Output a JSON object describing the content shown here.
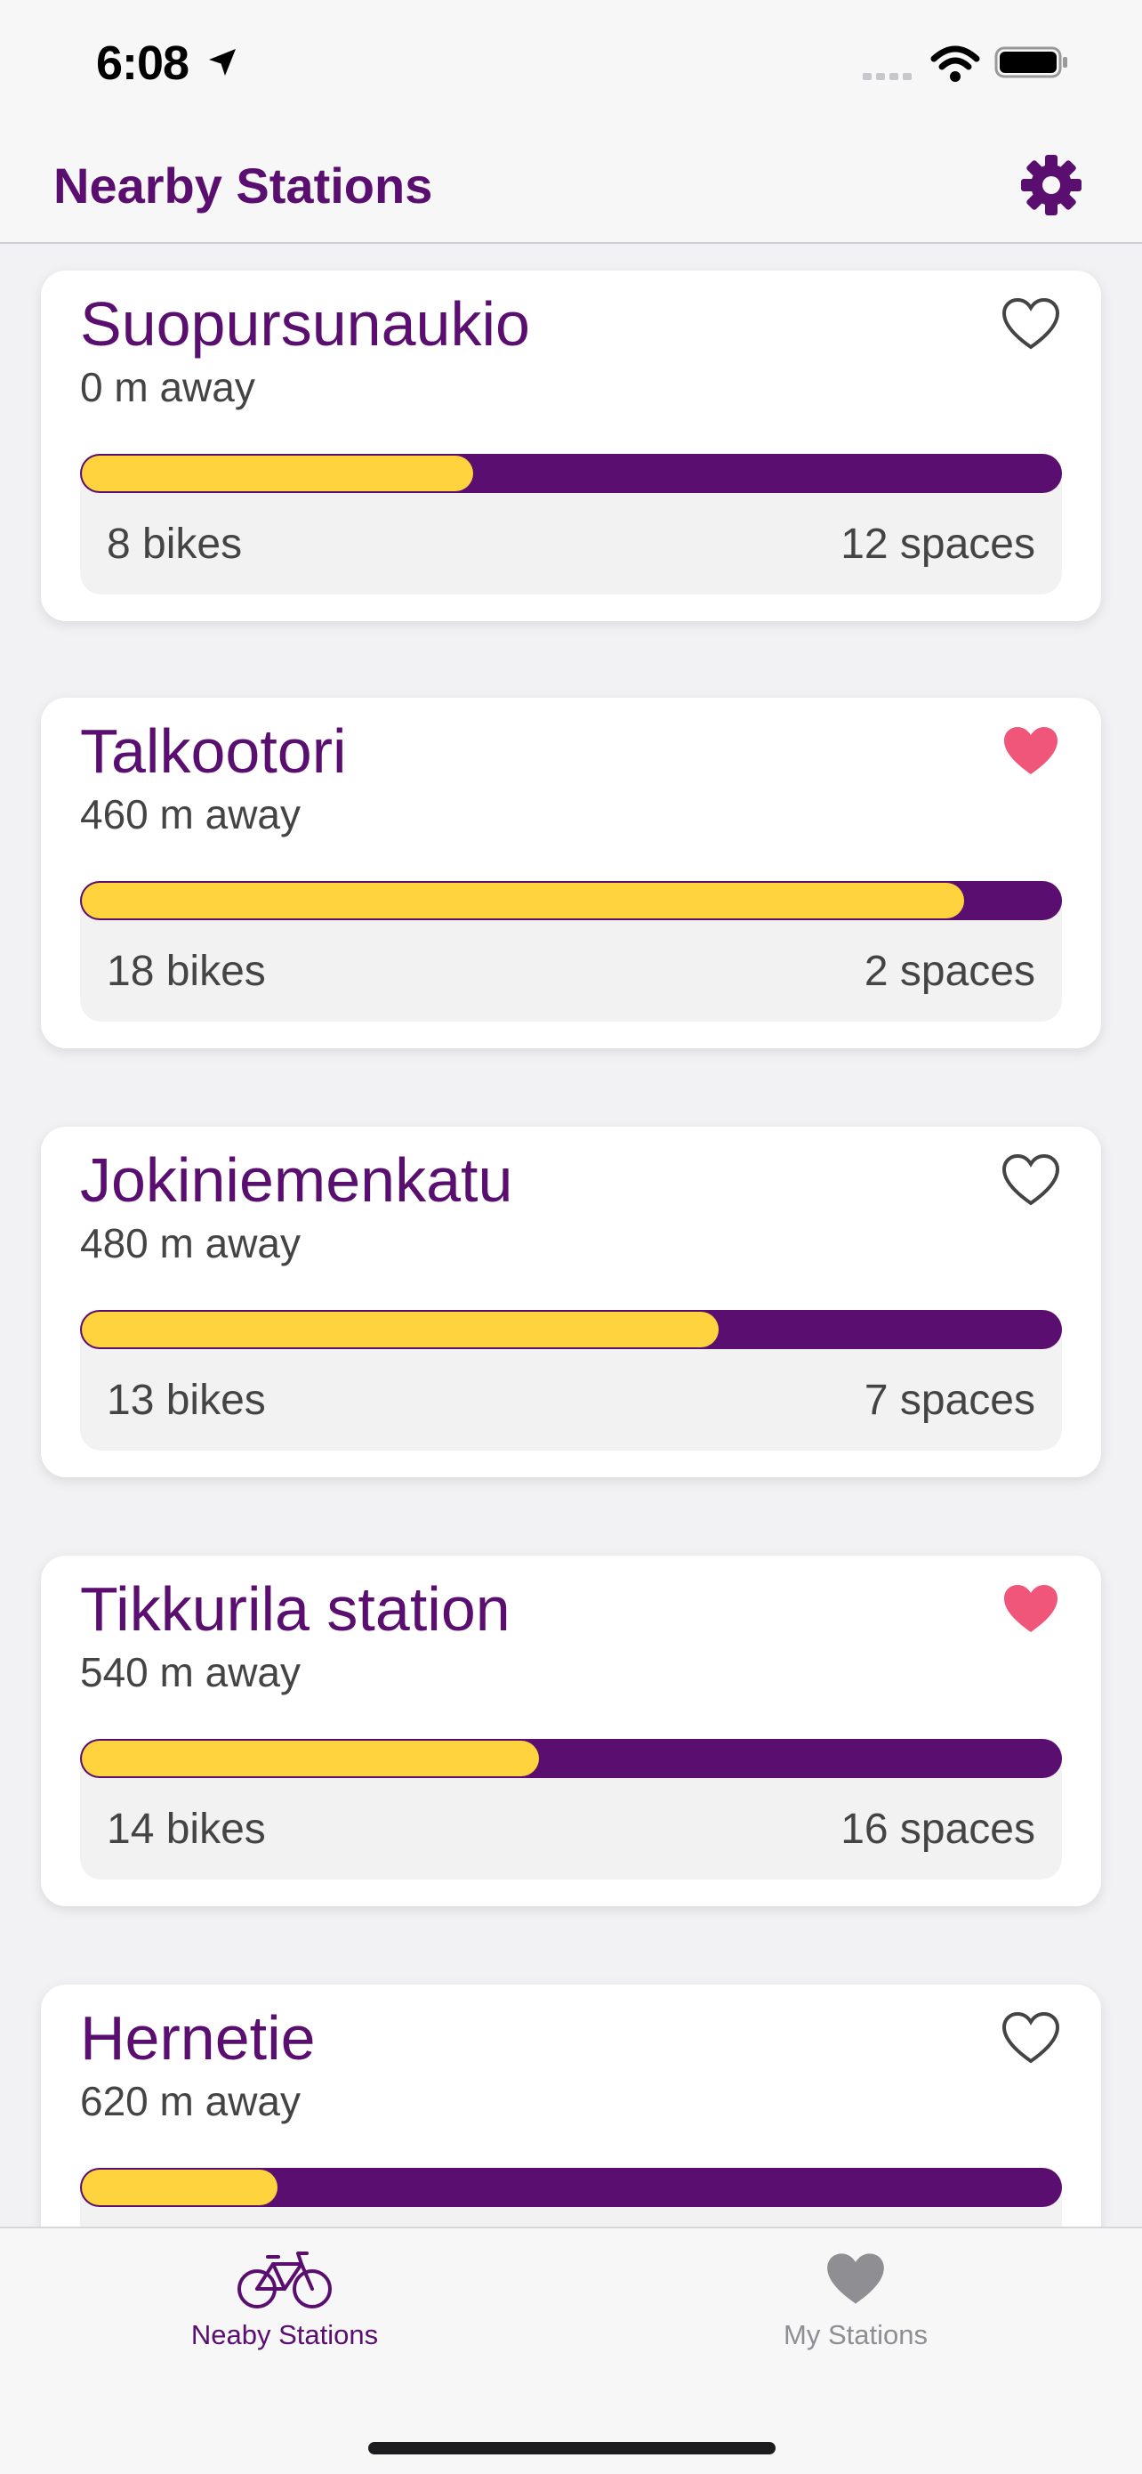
{
  "status_bar": {
    "time": "6:08"
  },
  "header": {
    "title": "Nearby Stations",
    "settings_icon": "gear-icon"
  },
  "colors": {
    "accent": "#5a0e6f",
    "bike_fill": "#ffd33d",
    "favorite": "#f0567a"
  },
  "stations": [
    {
      "name": "Suopursunaukio",
      "distance": "0 m away",
      "bikes": "8 bikes",
      "spaces": "12 spaces",
      "bike_fraction": 0.4,
      "favorite": false
    },
    {
      "name": "Talkootori",
      "distance": "460 m away",
      "bikes": "18 bikes",
      "spaces": "2 spaces",
      "bike_fraction": 0.9,
      "favorite": true
    },
    {
      "name": "Jokiniemenkatu",
      "distance": "480 m away",
      "bikes": "13 bikes",
      "spaces": "7 spaces",
      "bike_fraction": 0.65,
      "favorite": false
    },
    {
      "name": "Tikkurila station",
      "distance": "540 m away",
      "bikes": "14 bikes",
      "spaces": "16 spaces",
      "bike_fraction": 0.467,
      "favorite": true
    },
    {
      "name": "Hernetie",
      "distance": "620 m away",
      "bikes": "",
      "spaces": "",
      "bike_fraction": 0.2,
      "favorite": false
    }
  ],
  "tabs": [
    {
      "label": "Neaby Stations",
      "icon": "bicycle-icon",
      "selected": true
    },
    {
      "label": "My Stations",
      "icon": "heart-icon",
      "selected": false
    }
  ]
}
